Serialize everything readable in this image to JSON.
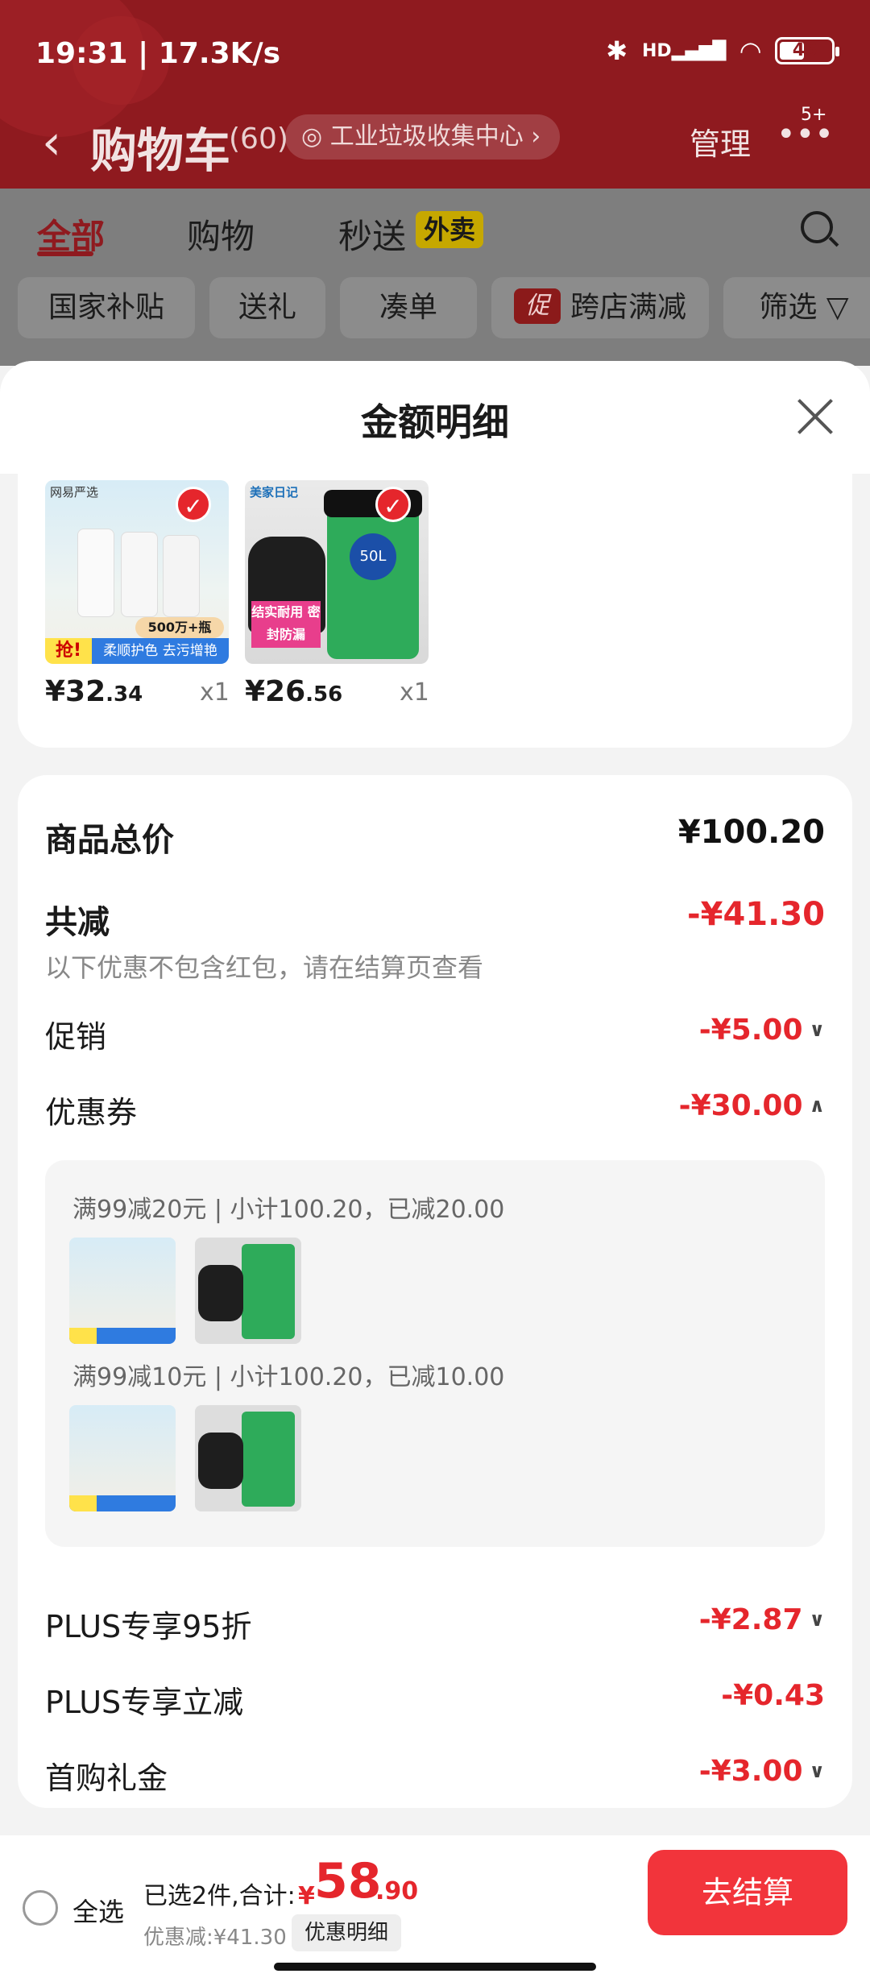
{
  "status": {
    "time": "19:31 | 17.3K/s",
    "signal": "HD",
    "battery": "46"
  },
  "nav": {
    "title": "购物车",
    "count": "(60)",
    "pill": "工业垃圾收集中心",
    "manage": "管理",
    "badge": "5+"
  },
  "tabs": [
    {
      "label": "全部"
    },
    {
      "label": "购物"
    },
    {
      "label": "秒送"
    }
  ],
  "waimai": "外卖",
  "filters": [
    {
      "label": "国家补贴"
    },
    {
      "label": "送礼"
    },
    {
      "label": "凑单"
    },
    {
      "label": "跨店满减",
      "tag": "促"
    },
    {
      "label": "筛选"
    }
  ],
  "sheet": {
    "title": "金额明细"
  },
  "items": [
    {
      "price_int": "¥32",
      "price_dec": ".34",
      "qty": "x1",
      "brand": "网易严选",
      "badge": "500万+瓶",
      "promo": "抢!",
      "caption": "柔顺护色 去污增艳"
    },
    {
      "price_int": "¥26",
      "price_dec": ".56",
      "qty": "x1",
      "brand": "美家日记",
      "size": "50L",
      "caption": "结实耐用 密封防漏"
    }
  ],
  "summary": {
    "total_label": "商品总价",
    "total_value": "¥100.20",
    "reduce_label": "共减",
    "reduce_value": "-¥41.30",
    "hint": "以下优惠不包含红包，请在结算页查看",
    "promo_label": "促销",
    "promo_value": "-¥5.00",
    "coupon_label": "优惠券",
    "coupon_value": "-¥30.00",
    "coupons": [
      {
        "text": "满99减20元 | 小计100.20，已减20.00"
      },
      {
        "text": "满99减10元 | 小计100.20，已减10.00"
      }
    ],
    "plus95_label": "PLUS专享95折",
    "plus95_value": "-¥2.87",
    "plusreduce_label": "PLUS专享立减",
    "plusreduce_value": "-¥0.43",
    "first_label": "首购礼金",
    "first_value": "-¥3.00"
  },
  "bottom": {
    "select_all": "全选",
    "selected_text": "已选2件,合计:",
    "currency": "¥",
    "total_int": "58",
    "total_dec": ".90",
    "saved": "优惠减:¥41.30",
    "detail_btn": "优惠明细",
    "checkout": "去结算"
  },
  "colors": {
    "brand_red": "#e5262c",
    "header_bg": "#8f1a1f",
    "checkout_bg": "#f2343b"
  }
}
